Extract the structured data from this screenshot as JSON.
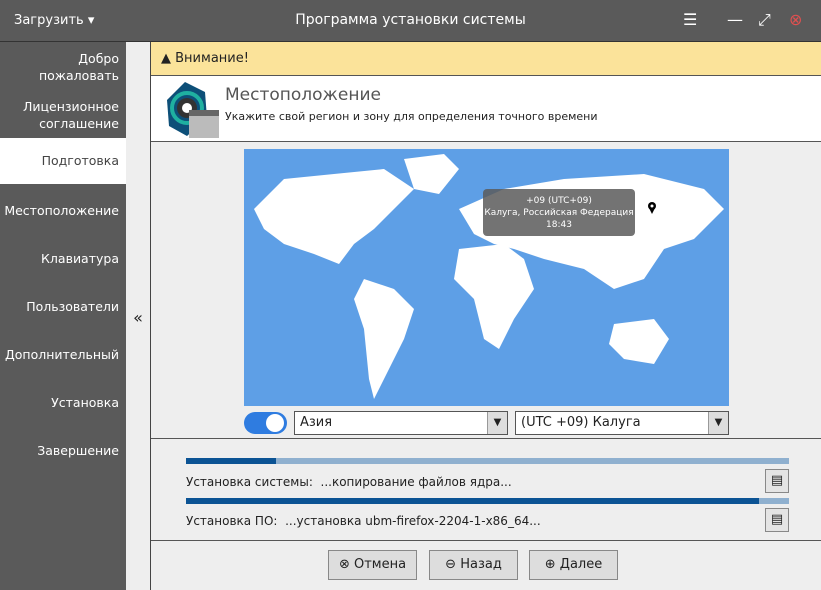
{
  "titlebar": {
    "load_menu": "Загрузить",
    "title": "Программа установки системы"
  },
  "sidebar": {
    "items": [
      {
        "label": "Добро пожаловать"
      },
      {
        "label": "Лицензионное соглашение"
      },
      {
        "label": "Подготовка"
      },
      {
        "label": "Местоположение"
      },
      {
        "label": "Клавиатура"
      },
      {
        "label": "Пользователи"
      },
      {
        "label": "Дополнительный"
      },
      {
        "label": "Установка"
      },
      {
        "label": "Завершение"
      }
    ],
    "collapse": "«"
  },
  "warning": "Внимание!",
  "header": {
    "title": "Местоположение",
    "subtitle": "Укажите свой регион и зону для определения точного времени"
  },
  "map": {
    "tooltip_zone": "+09 (UTC+09)",
    "tooltip_place": "Калуга, Российская Федерация",
    "tooltip_time": "18:43"
  },
  "region": {
    "value": "Азия"
  },
  "zone": {
    "value": "(UTC +09) Калуга"
  },
  "ntp_toggle": true,
  "progress": [
    {
      "label": "Установка системы:",
      "status": "...копирование файлов ядра...",
      "percent": 15
    },
    {
      "label": "Установка ПО:",
      "status": "...установка ubm-firefox-2204-1-x86_64...",
      "percent": 95
    }
  ],
  "buttons": {
    "cancel": "Отмена",
    "back": "Назад",
    "next": "Далее"
  },
  "colors": {
    "accent": "#2f7ce0",
    "progress": "#0b5394",
    "warning": "#fbe39a"
  }
}
